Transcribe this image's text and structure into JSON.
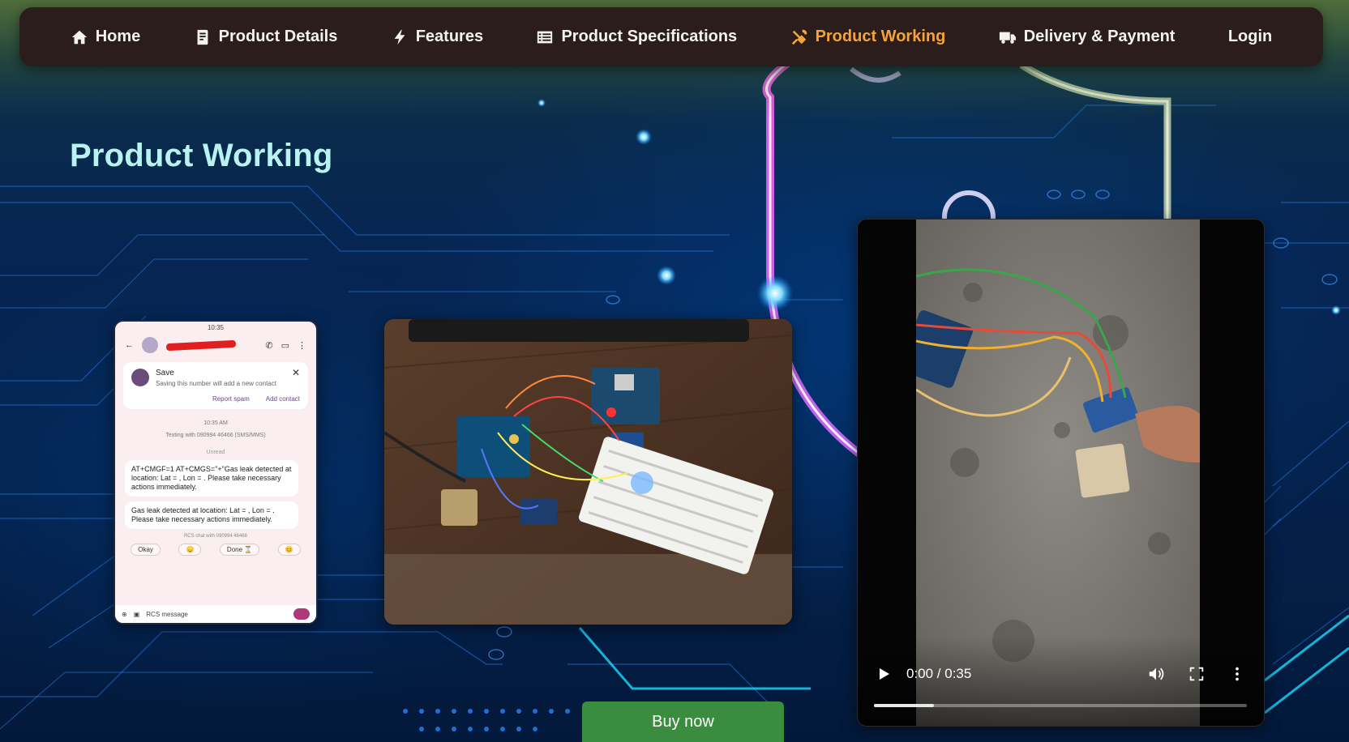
{
  "nav": {
    "items": [
      {
        "label": "Home",
        "icon": "home-icon"
      },
      {
        "label": "Product Details",
        "icon": "document-icon"
      },
      {
        "label": "Features",
        "icon": "bolt-icon"
      },
      {
        "label": "Product Specifications",
        "icon": "list-icon"
      },
      {
        "label": "Product Working",
        "icon": "tools-icon",
        "active": true
      },
      {
        "label": "Delivery & Payment",
        "icon": "truck-icon"
      },
      {
        "label": "Login",
        "icon": ""
      }
    ],
    "active_color": "#f5a33a",
    "bg_color": "#2a1d1b"
  },
  "page": {
    "title": "Product Working",
    "title_color": "#b8f3f2"
  },
  "phone_screenshot": {
    "status_time": "10:35",
    "save_title": "Save",
    "save_subtitle": "Saving this number will add a new contact",
    "report_spam": "Report spam",
    "add_contact": "Add contact",
    "time": "10:35 AM",
    "texting_with": "Texting with 090994 46466 (SMS/MMS)",
    "unread": "Unread",
    "message_1": "AT+CMGF=1 AT+CMGS=\"+\"Gas leak detected at location: Lat = , Lon = . Please take necessary actions immediately.",
    "message_2": "Gas leak detected at location: Lat = , Lon = . Please take necessary actions immediately.",
    "rcs_chat": "RCS chat with 090994 46466",
    "chips": [
      "Okay",
      "😞",
      "Done ⌛",
      "😊"
    ],
    "input_placeholder": "RCS message"
  },
  "video": {
    "current_time": "0:00",
    "duration": "0:35",
    "time_display": "0:00 / 0:35",
    "progress_fraction": 0.16
  },
  "buy_button": {
    "label": "Buy now",
    "color": "#3a8d3f"
  }
}
